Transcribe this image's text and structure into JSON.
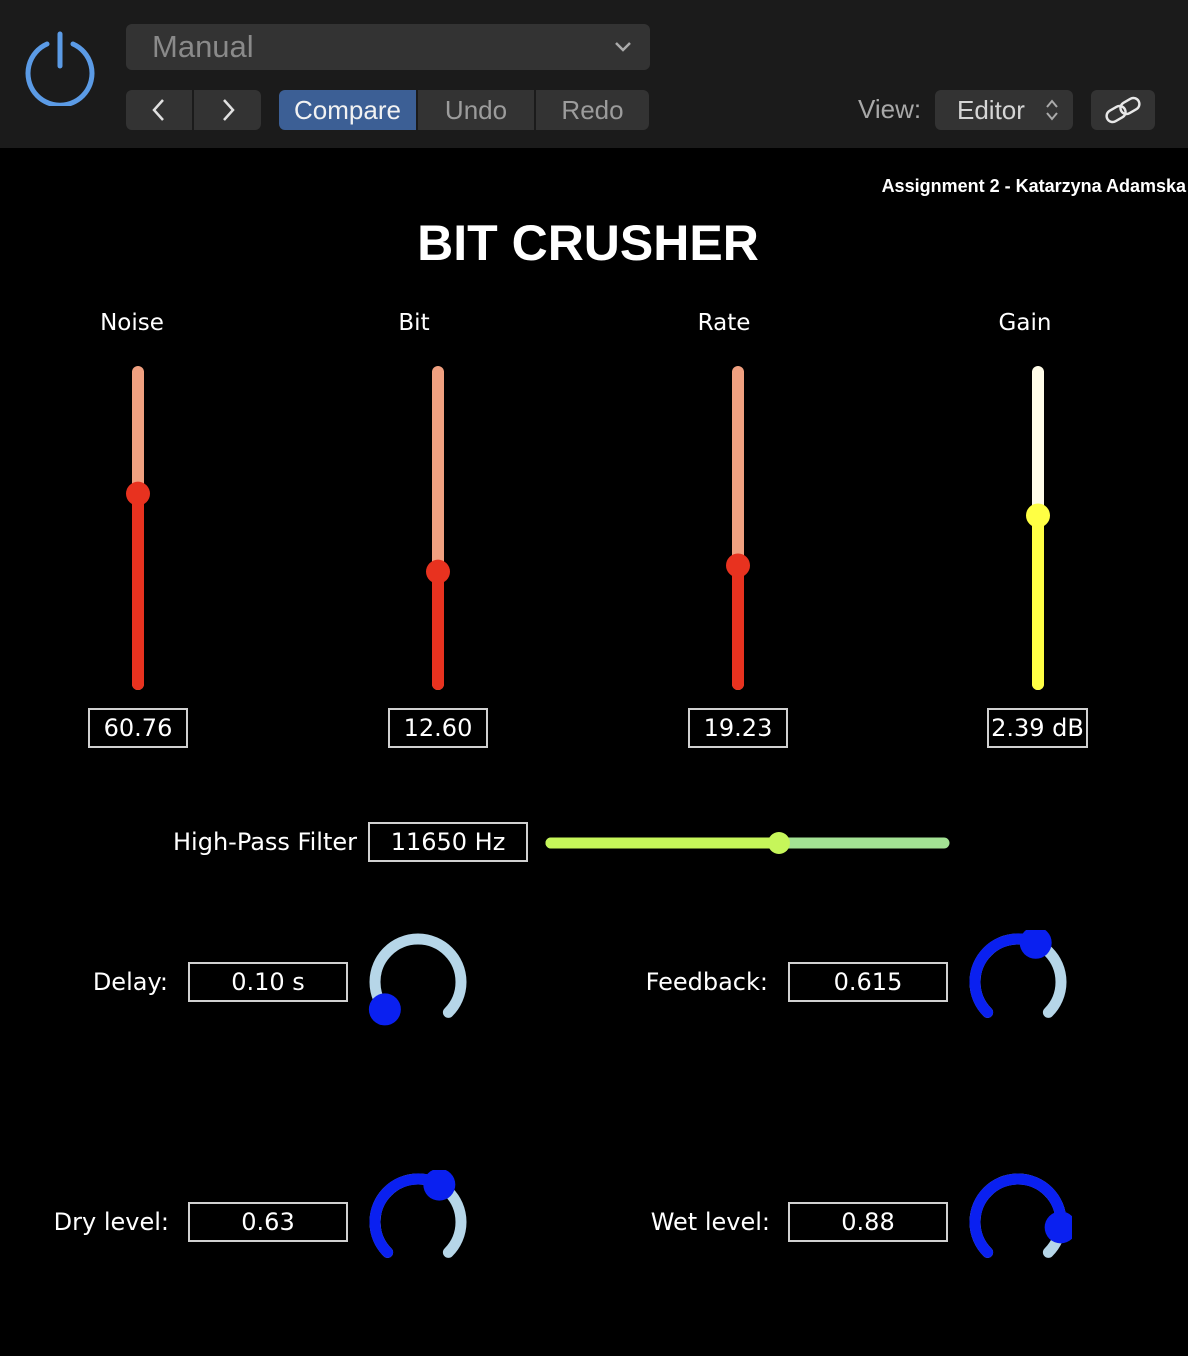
{
  "header": {
    "preset": "Manual",
    "compare_label": "Compare",
    "undo_label": "Undo",
    "redo_label": "Redo",
    "view_label": "View:",
    "view_value": "Editor"
  },
  "plugin": {
    "author": "Assignment 2 - Katarzyna Adamska",
    "title": "BIT CRUSHER",
    "sliders": [
      {
        "label": "Noise",
        "value": "60.76",
        "level": 0.61,
        "color": "#e8321f",
        "track": "#f0a080"
      },
      {
        "label": "Bit",
        "value": "12.60",
        "level": 0.36,
        "color": "#e8321f",
        "track": "#f0a080"
      },
      {
        "label": "Rate",
        "value": "19.23",
        "level": 0.38,
        "color": "#e8321f",
        "track": "#f0a080"
      },
      {
        "label": "Gain",
        "value": "2.39 dB",
        "level": 0.54,
        "color": "#ffff44",
        "track": "#fffce8"
      }
    ],
    "hpf": {
      "label": "High-Pass Filter",
      "value": "11650 Hz",
      "level": 0.58,
      "color": "#c6f65a",
      "track": "#a3e294"
    },
    "knobs": {
      "delay": {
        "label": "Delay:",
        "value": "0.10 s",
        "level": 0.02
      },
      "feedback": {
        "label": "Feedback:",
        "value": "0.615",
        "level": 0.59
      },
      "dry": {
        "label": "Dry level:",
        "value": "0.63",
        "level": 0.61
      },
      "wet": {
        "label": "Wet level:",
        "value": "0.88",
        "level": 0.86
      }
    },
    "knob_colors": {
      "fill": "#0a20f0",
      "track": "#b6d6e8"
    }
  }
}
